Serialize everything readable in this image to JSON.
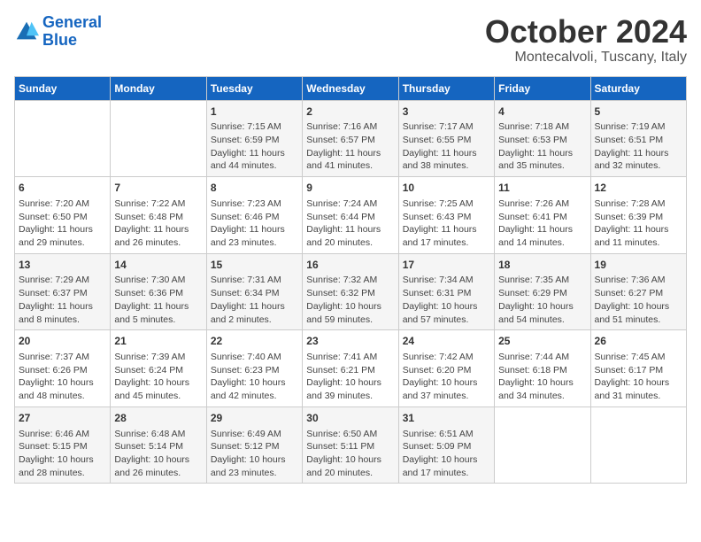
{
  "logo": {
    "line1": "General",
    "line2": "Blue"
  },
  "title": "October 2024",
  "location": "Montecalvoli, Tuscany, Italy",
  "headers": [
    "Sunday",
    "Monday",
    "Tuesday",
    "Wednesday",
    "Thursday",
    "Friday",
    "Saturday"
  ],
  "weeks": [
    [
      {
        "day": "",
        "info": ""
      },
      {
        "day": "",
        "info": ""
      },
      {
        "day": "1",
        "info": "Sunrise: 7:15 AM\nSunset: 6:59 PM\nDaylight: 11 hours and 44 minutes."
      },
      {
        "day": "2",
        "info": "Sunrise: 7:16 AM\nSunset: 6:57 PM\nDaylight: 11 hours and 41 minutes."
      },
      {
        "day": "3",
        "info": "Sunrise: 7:17 AM\nSunset: 6:55 PM\nDaylight: 11 hours and 38 minutes."
      },
      {
        "day": "4",
        "info": "Sunrise: 7:18 AM\nSunset: 6:53 PM\nDaylight: 11 hours and 35 minutes."
      },
      {
        "day": "5",
        "info": "Sunrise: 7:19 AM\nSunset: 6:51 PM\nDaylight: 11 hours and 32 minutes."
      }
    ],
    [
      {
        "day": "6",
        "info": "Sunrise: 7:20 AM\nSunset: 6:50 PM\nDaylight: 11 hours and 29 minutes."
      },
      {
        "day": "7",
        "info": "Sunrise: 7:22 AM\nSunset: 6:48 PM\nDaylight: 11 hours and 26 minutes."
      },
      {
        "day": "8",
        "info": "Sunrise: 7:23 AM\nSunset: 6:46 PM\nDaylight: 11 hours and 23 minutes."
      },
      {
        "day": "9",
        "info": "Sunrise: 7:24 AM\nSunset: 6:44 PM\nDaylight: 11 hours and 20 minutes."
      },
      {
        "day": "10",
        "info": "Sunrise: 7:25 AM\nSunset: 6:43 PM\nDaylight: 11 hours and 17 minutes."
      },
      {
        "day": "11",
        "info": "Sunrise: 7:26 AM\nSunset: 6:41 PM\nDaylight: 11 hours and 14 minutes."
      },
      {
        "day": "12",
        "info": "Sunrise: 7:28 AM\nSunset: 6:39 PM\nDaylight: 11 hours and 11 minutes."
      }
    ],
    [
      {
        "day": "13",
        "info": "Sunrise: 7:29 AM\nSunset: 6:37 PM\nDaylight: 11 hours and 8 minutes."
      },
      {
        "day": "14",
        "info": "Sunrise: 7:30 AM\nSunset: 6:36 PM\nDaylight: 11 hours and 5 minutes."
      },
      {
        "day": "15",
        "info": "Sunrise: 7:31 AM\nSunset: 6:34 PM\nDaylight: 11 hours and 2 minutes."
      },
      {
        "day": "16",
        "info": "Sunrise: 7:32 AM\nSunset: 6:32 PM\nDaylight: 10 hours and 59 minutes."
      },
      {
        "day": "17",
        "info": "Sunrise: 7:34 AM\nSunset: 6:31 PM\nDaylight: 10 hours and 57 minutes."
      },
      {
        "day": "18",
        "info": "Sunrise: 7:35 AM\nSunset: 6:29 PM\nDaylight: 10 hours and 54 minutes."
      },
      {
        "day": "19",
        "info": "Sunrise: 7:36 AM\nSunset: 6:27 PM\nDaylight: 10 hours and 51 minutes."
      }
    ],
    [
      {
        "day": "20",
        "info": "Sunrise: 7:37 AM\nSunset: 6:26 PM\nDaylight: 10 hours and 48 minutes."
      },
      {
        "day": "21",
        "info": "Sunrise: 7:39 AM\nSunset: 6:24 PM\nDaylight: 10 hours and 45 minutes."
      },
      {
        "day": "22",
        "info": "Sunrise: 7:40 AM\nSunset: 6:23 PM\nDaylight: 10 hours and 42 minutes."
      },
      {
        "day": "23",
        "info": "Sunrise: 7:41 AM\nSunset: 6:21 PM\nDaylight: 10 hours and 39 minutes."
      },
      {
        "day": "24",
        "info": "Sunrise: 7:42 AM\nSunset: 6:20 PM\nDaylight: 10 hours and 37 minutes."
      },
      {
        "day": "25",
        "info": "Sunrise: 7:44 AM\nSunset: 6:18 PM\nDaylight: 10 hours and 34 minutes."
      },
      {
        "day": "26",
        "info": "Sunrise: 7:45 AM\nSunset: 6:17 PM\nDaylight: 10 hours and 31 minutes."
      }
    ],
    [
      {
        "day": "27",
        "info": "Sunrise: 6:46 AM\nSunset: 5:15 PM\nDaylight: 10 hours and 28 minutes."
      },
      {
        "day": "28",
        "info": "Sunrise: 6:48 AM\nSunset: 5:14 PM\nDaylight: 10 hours and 26 minutes."
      },
      {
        "day": "29",
        "info": "Sunrise: 6:49 AM\nSunset: 5:12 PM\nDaylight: 10 hours and 23 minutes."
      },
      {
        "day": "30",
        "info": "Sunrise: 6:50 AM\nSunset: 5:11 PM\nDaylight: 10 hours and 20 minutes."
      },
      {
        "day": "31",
        "info": "Sunrise: 6:51 AM\nSunset: 5:09 PM\nDaylight: 10 hours and 17 minutes."
      },
      {
        "day": "",
        "info": ""
      },
      {
        "day": "",
        "info": ""
      }
    ]
  ]
}
